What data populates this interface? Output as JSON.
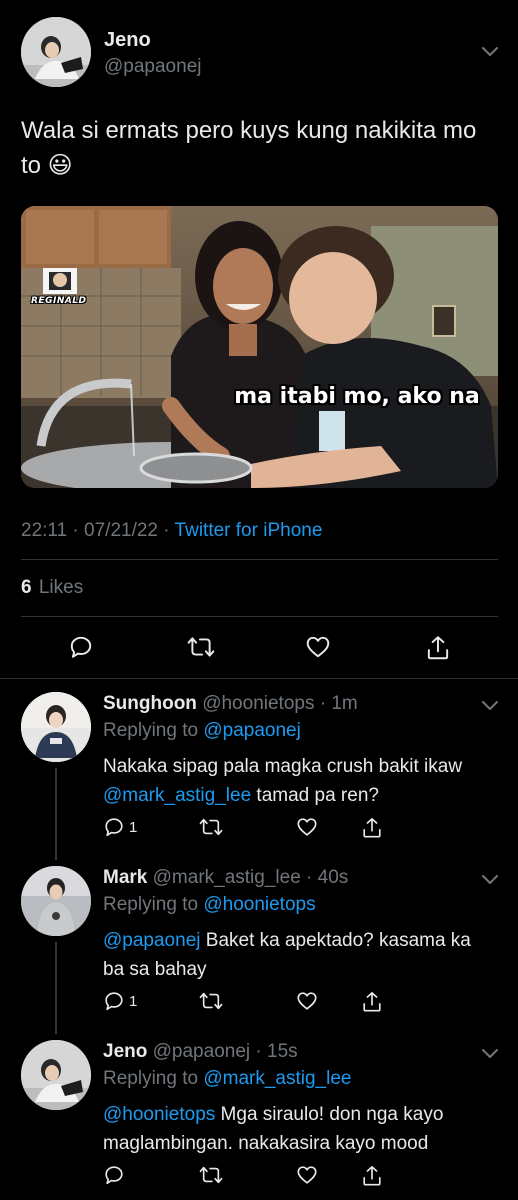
{
  "tweet": {
    "name": "Jeno",
    "handle": "@papaonej",
    "text": "Wala si ermats pero kuys kung nakikita mo to 😃",
    "image": {
      "watermark": "REGINALD",
      "caption": "ma itabi mo, ako na"
    },
    "time": "22:11",
    "date": "07/21/22",
    "client": "Twitter for iPhone",
    "likes_count": "6",
    "likes_label": "Likes"
  },
  "replies": [
    {
      "name": "Sunghoon",
      "handle": "@hoonietops",
      "time": "1m",
      "replying_label": "Replying to",
      "replying_to": "@papaonej",
      "text_before": "Nakaka sipag pala magka crush bakit ikaw",
      "mention": "@mark_astig_lee",
      "text_after": "tamad pa ren?",
      "reply_count": "1"
    },
    {
      "name": "Mark",
      "handle": "@mark_astig_lee",
      "time": "40s",
      "replying_label": "Replying to",
      "replying_to": "@hoonietops",
      "mention": "@papaonej",
      "text_after": "Baket ka apektado? kasama ka ba sa bahay",
      "reply_count": "1"
    },
    {
      "name": "Jeno",
      "handle": "@papaonej",
      "time": "15s",
      "replying_label": "Replying to",
      "replying_to": "@mark_astig_lee",
      "mention": "@hoonietops",
      "text_after": "Mga siraulo! don nga kayo maglambingan. nakakasira kayo mood",
      "reply_count": ""
    }
  ],
  "icons": {
    "reply": "reply-icon",
    "retweet": "retweet-icon",
    "like": "heart-icon",
    "share": "share-icon",
    "more": "chevron-down-icon"
  },
  "colors": {
    "background": "#000000",
    "text": "#e7e9ea",
    "muted": "#71767b",
    "link": "#1d9bf0",
    "divider": "#2f3336"
  }
}
